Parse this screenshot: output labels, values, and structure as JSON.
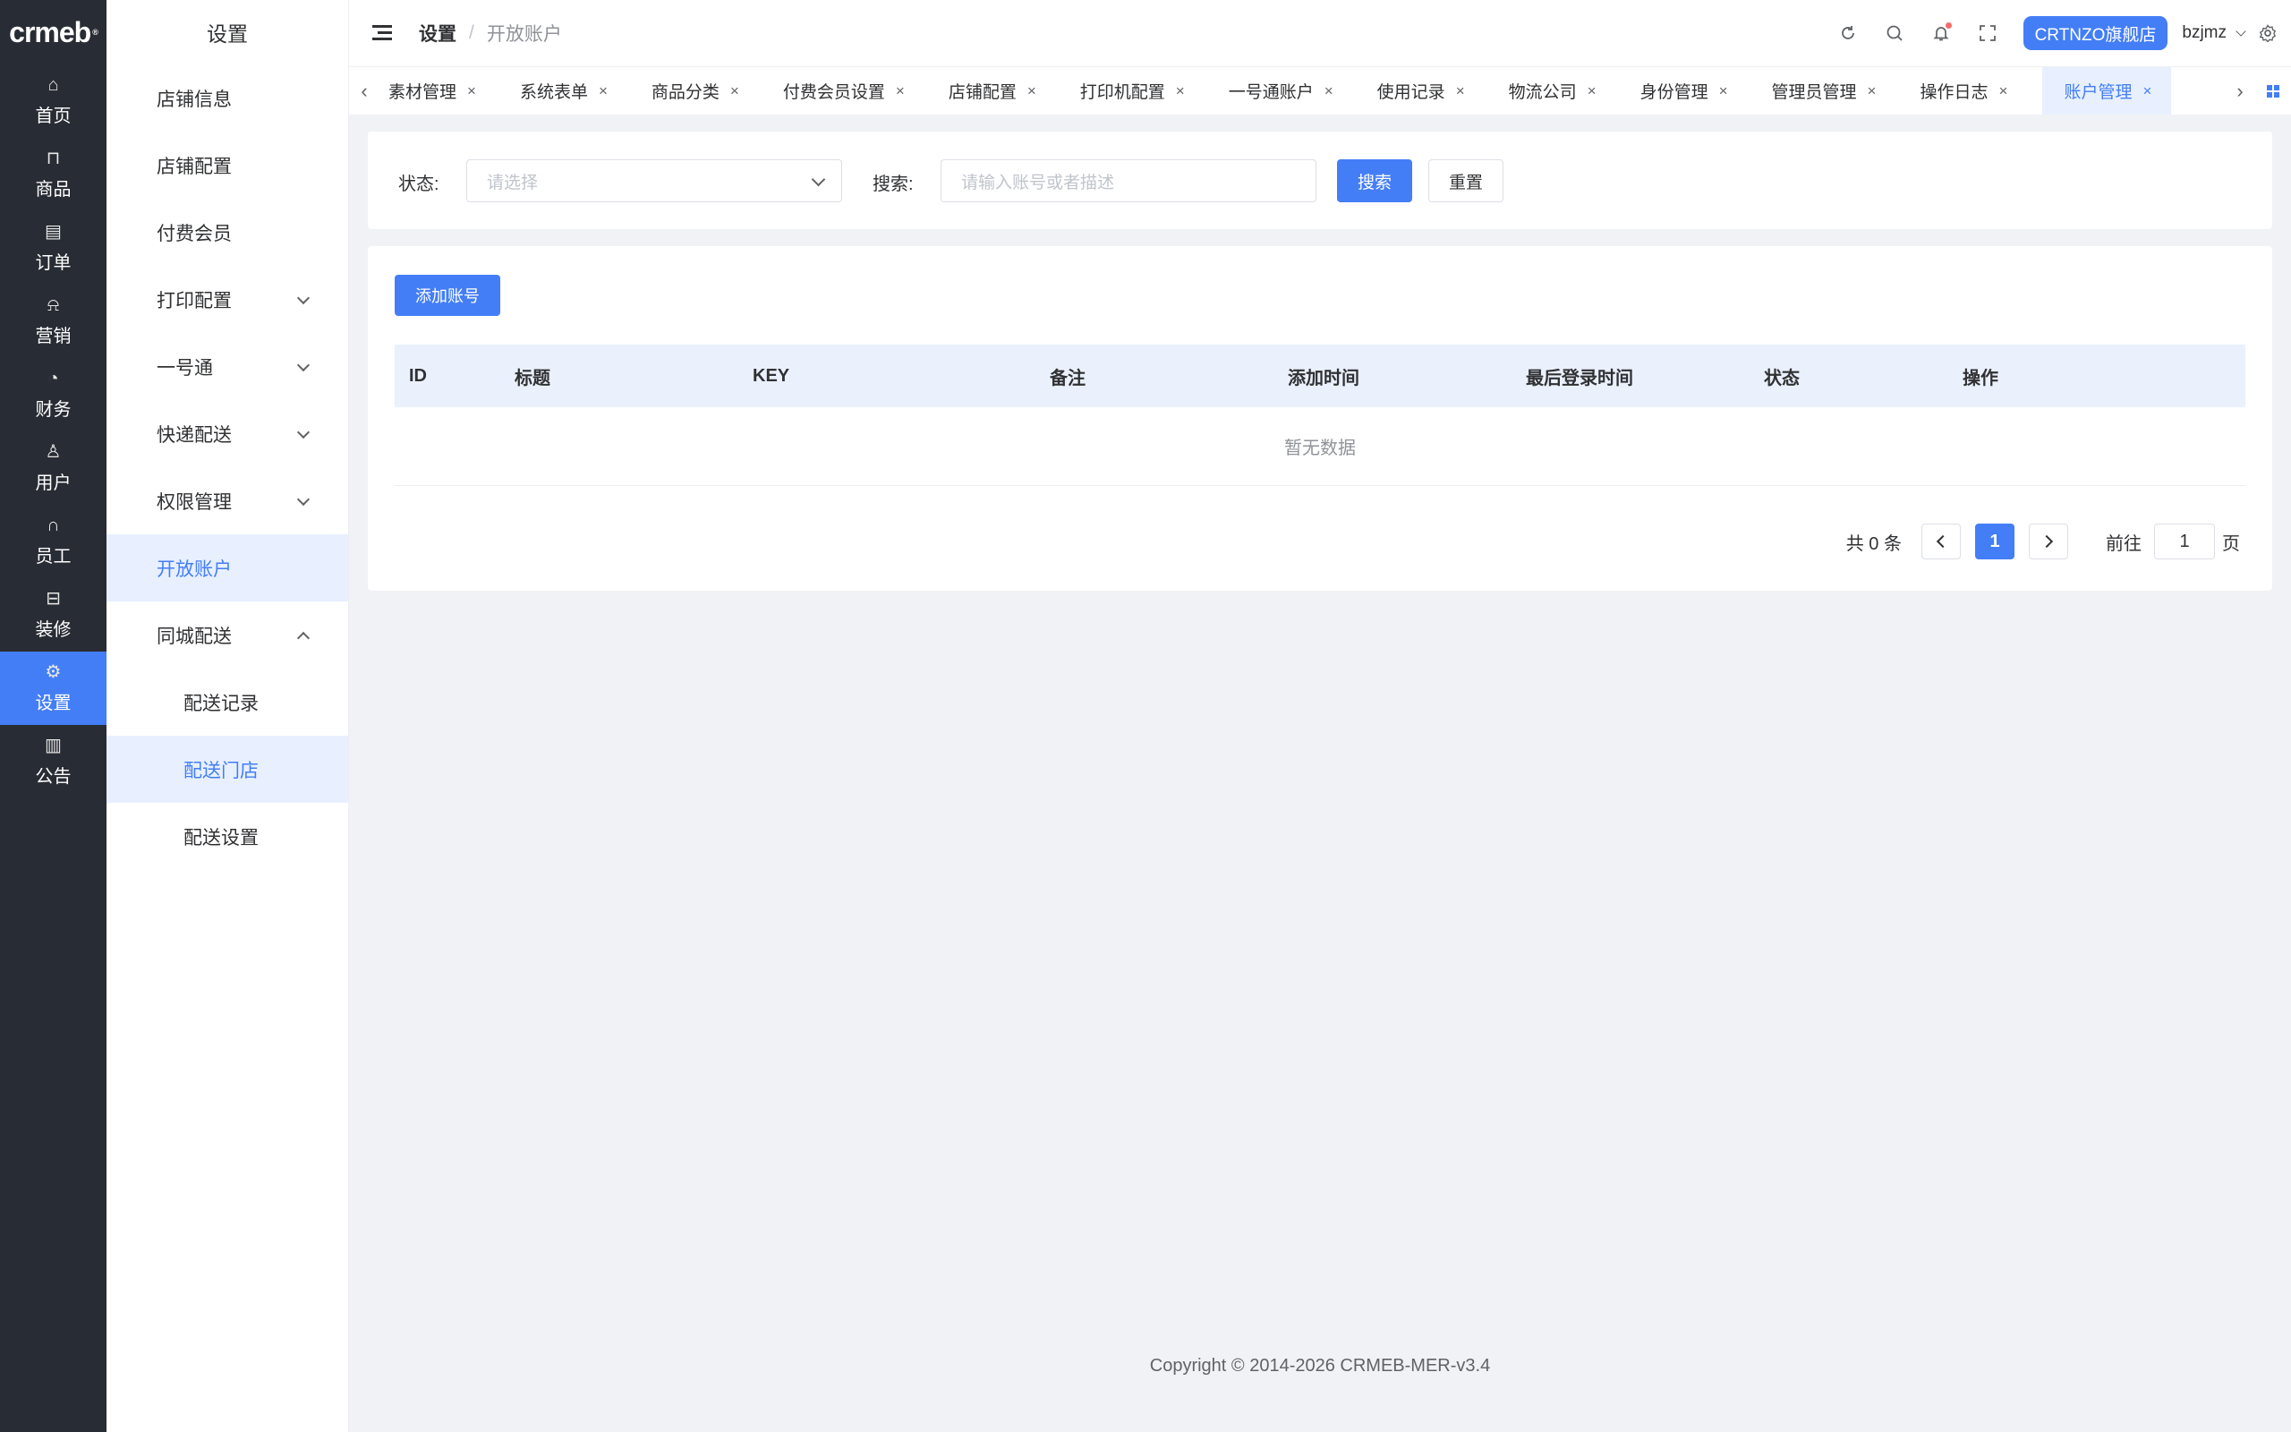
{
  "brand": {
    "logo_text": "crmeb",
    "logo_mark": "®"
  },
  "rail": {
    "items": [
      {
        "label": "首页",
        "icon": "home-icon",
        "glyph": "⌂"
      },
      {
        "label": "商品",
        "icon": "bag-icon",
        "glyph": "⊓"
      },
      {
        "label": "订单",
        "icon": "order-icon",
        "glyph": "▤"
      },
      {
        "label": "营销",
        "icon": "bell-icon",
        "glyph": "⍾"
      },
      {
        "label": "财务",
        "icon": "pie-icon",
        "glyph": "◔"
      },
      {
        "label": "用户",
        "icon": "user-icon",
        "glyph": "♙"
      },
      {
        "label": "员工",
        "icon": "headset-icon",
        "glyph": "∩"
      },
      {
        "label": "装修",
        "icon": "decor-icon",
        "glyph": "⊟"
      },
      {
        "label": "设置",
        "icon": "gear-icon",
        "glyph": "⚙"
      },
      {
        "label": "公告",
        "icon": "notice-icon",
        "glyph": "▥"
      }
    ],
    "active_index": 8
  },
  "submenu": {
    "title": "设置",
    "items": [
      {
        "label": "店铺信息"
      },
      {
        "label": "店铺配置"
      },
      {
        "label": "付费会员"
      },
      {
        "label": "打印配置"
      },
      {
        "label": "一号通"
      },
      {
        "label": "快递配送"
      },
      {
        "label": "权限管理"
      },
      {
        "label": "开放账户"
      },
      {
        "label": "同城配送"
      },
      {
        "label": "配送记录"
      },
      {
        "label": "配送门店"
      },
      {
        "label": "配送设置"
      }
    ]
  },
  "header": {
    "breadcrumb_root": "设置",
    "breadcrumb_sep": "/",
    "breadcrumb_current": "开放账户",
    "store_button": "CRTNZO旗舰店",
    "username": "bzjmz"
  },
  "tabs": {
    "items": [
      {
        "label": "素材管理"
      },
      {
        "label": "系统表单"
      },
      {
        "label": "商品分类"
      },
      {
        "label": "付费会员设置"
      },
      {
        "label": "店铺配置"
      },
      {
        "label": "打印机配置"
      },
      {
        "label": "一号通账户"
      },
      {
        "label": "使用记录"
      },
      {
        "label": "物流公司"
      },
      {
        "label": "身份管理"
      },
      {
        "label": "管理员管理"
      },
      {
        "label": "操作日志"
      },
      {
        "label": "账户管理"
      }
    ],
    "close_glyph": "×"
  },
  "filter": {
    "status_label": "状态:",
    "status_placeholder": "请选择",
    "search_label": "搜索:",
    "search_placeholder": "请输入账号或者描述",
    "search_button": "搜索",
    "reset_button": "重置"
  },
  "table": {
    "add_button": "添加账号",
    "columns": [
      "ID",
      "标题",
      "KEY",
      "备注",
      "添加时间",
      "最后登录时间",
      "状态",
      "操作"
    ],
    "empty_text": "暂无数据"
  },
  "pagination": {
    "total_text": "共 0 条",
    "current_page": "1",
    "goto_label": "前往",
    "goto_value": "1",
    "page_suffix": "页"
  },
  "footer": {
    "copyright": "Copyright © 2014-2026 CRMEB-MER-v3.4"
  },
  "colors": {
    "primary": "#437ef7",
    "rail_bg": "#282c34",
    "page_bg": "#f0f2f5"
  }
}
